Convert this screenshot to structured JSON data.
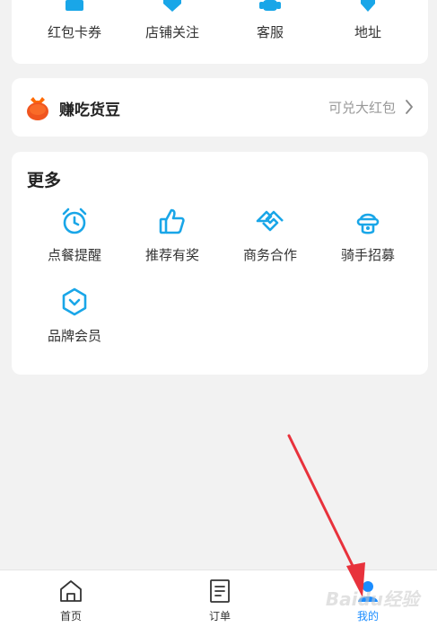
{
  "top_card": {
    "items": [
      {
        "label": "红包卡券",
        "icon": "coupon-icon"
      },
      {
        "label": "店铺关注",
        "icon": "store-follow-icon"
      },
      {
        "label": "客服",
        "icon": "customer-service-icon"
      },
      {
        "label": "地址",
        "icon": "location-icon"
      }
    ]
  },
  "beans": {
    "title": "赚吃货豆",
    "right_text": "可兑大红包",
    "icon": "money-bag-icon"
  },
  "more": {
    "title": "更多",
    "items": [
      {
        "label": "点餐提醒",
        "icon": "alarm-clock-icon"
      },
      {
        "label": "推荐有奖",
        "icon": "thumbs-up-icon"
      },
      {
        "label": "商务合作",
        "icon": "handshake-icon"
      },
      {
        "label": "骑手招募",
        "icon": "rider-icon"
      },
      {
        "label": "品牌会员",
        "icon": "brand-member-icon"
      }
    ]
  },
  "tabbar": {
    "tabs": [
      {
        "label": "首页",
        "icon": "home-icon"
      },
      {
        "label": "订单",
        "icon": "order-icon"
      },
      {
        "label": "我的",
        "icon": "profile-icon",
        "active": true
      }
    ]
  },
  "watermark": "Baidu经验",
  "colors": {
    "accent": "#1a8cff",
    "icon_blue": "#19a6e8",
    "arrow": "#e8323c",
    "background": "#f2f2f2"
  }
}
